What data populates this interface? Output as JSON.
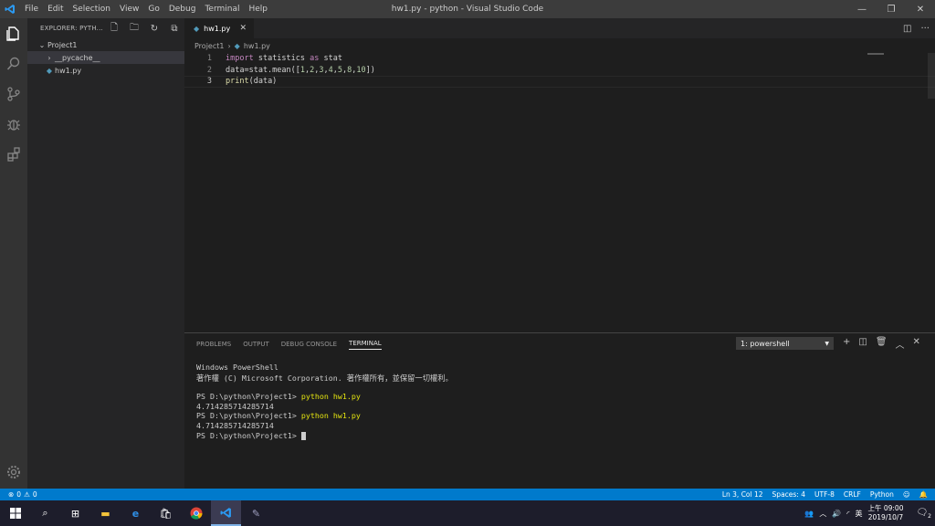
{
  "titlebar": {
    "menu": [
      "File",
      "Edit",
      "Selection",
      "View",
      "Go",
      "Debug",
      "Terminal",
      "Help"
    ],
    "title": "hw1.py - python - Visual Studio Code"
  },
  "sidebar": {
    "header": "EXPLORER: PYTH...",
    "project": "Project1",
    "items": [
      {
        "label": "__pycache__"
      },
      {
        "label": "hw1.py"
      }
    ]
  },
  "editor": {
    "tab_label": "hw1.py",
    "breadcrumb_root": "Project1",
    "breadcrumb_file": "hw1.py",
    "line_numbers": [
      "1",
      "2",
      "3"
    ]
  },
  "panel": {
    "tabs": [
      "PROBLEMS",
      "OUTPUT",
      "DEBUG CONSOLE",
      "TERMINAL"
    ],
    "terminal_select": "1: powershell",
    "lines": {
      "l1": "Windows PowerShell",
      "l2": "著作權 (C) Microsoft Corporation. 著作權所有，並保留一切權利。",
      "prompt": "PS D:\\python\\Project1> ",
      "cmd": "python hw1.py",
      "out": "4.714285714285714"
    }
  },
  "statusbar": {
    "errors": "0",
    "warnings": "0",
    "position": "Ln 3, Col 12",
    "spaces": "Spaces: 4",
    "encoding": "UTF-8",
    "eol": "CRLF",
    "language": "Python"
  },
  "taskbar": {
    "lang": "英",
    "time": "上午 09:00",
    "date": "2019/10/7",
    "notif_count": "2"
  },
  "colors": {
    "accent": "#007acc",
    "keyword": "#c586c0",
    "function": "#dcdcaa",
    "number": "#b5cea8"
  }
}
